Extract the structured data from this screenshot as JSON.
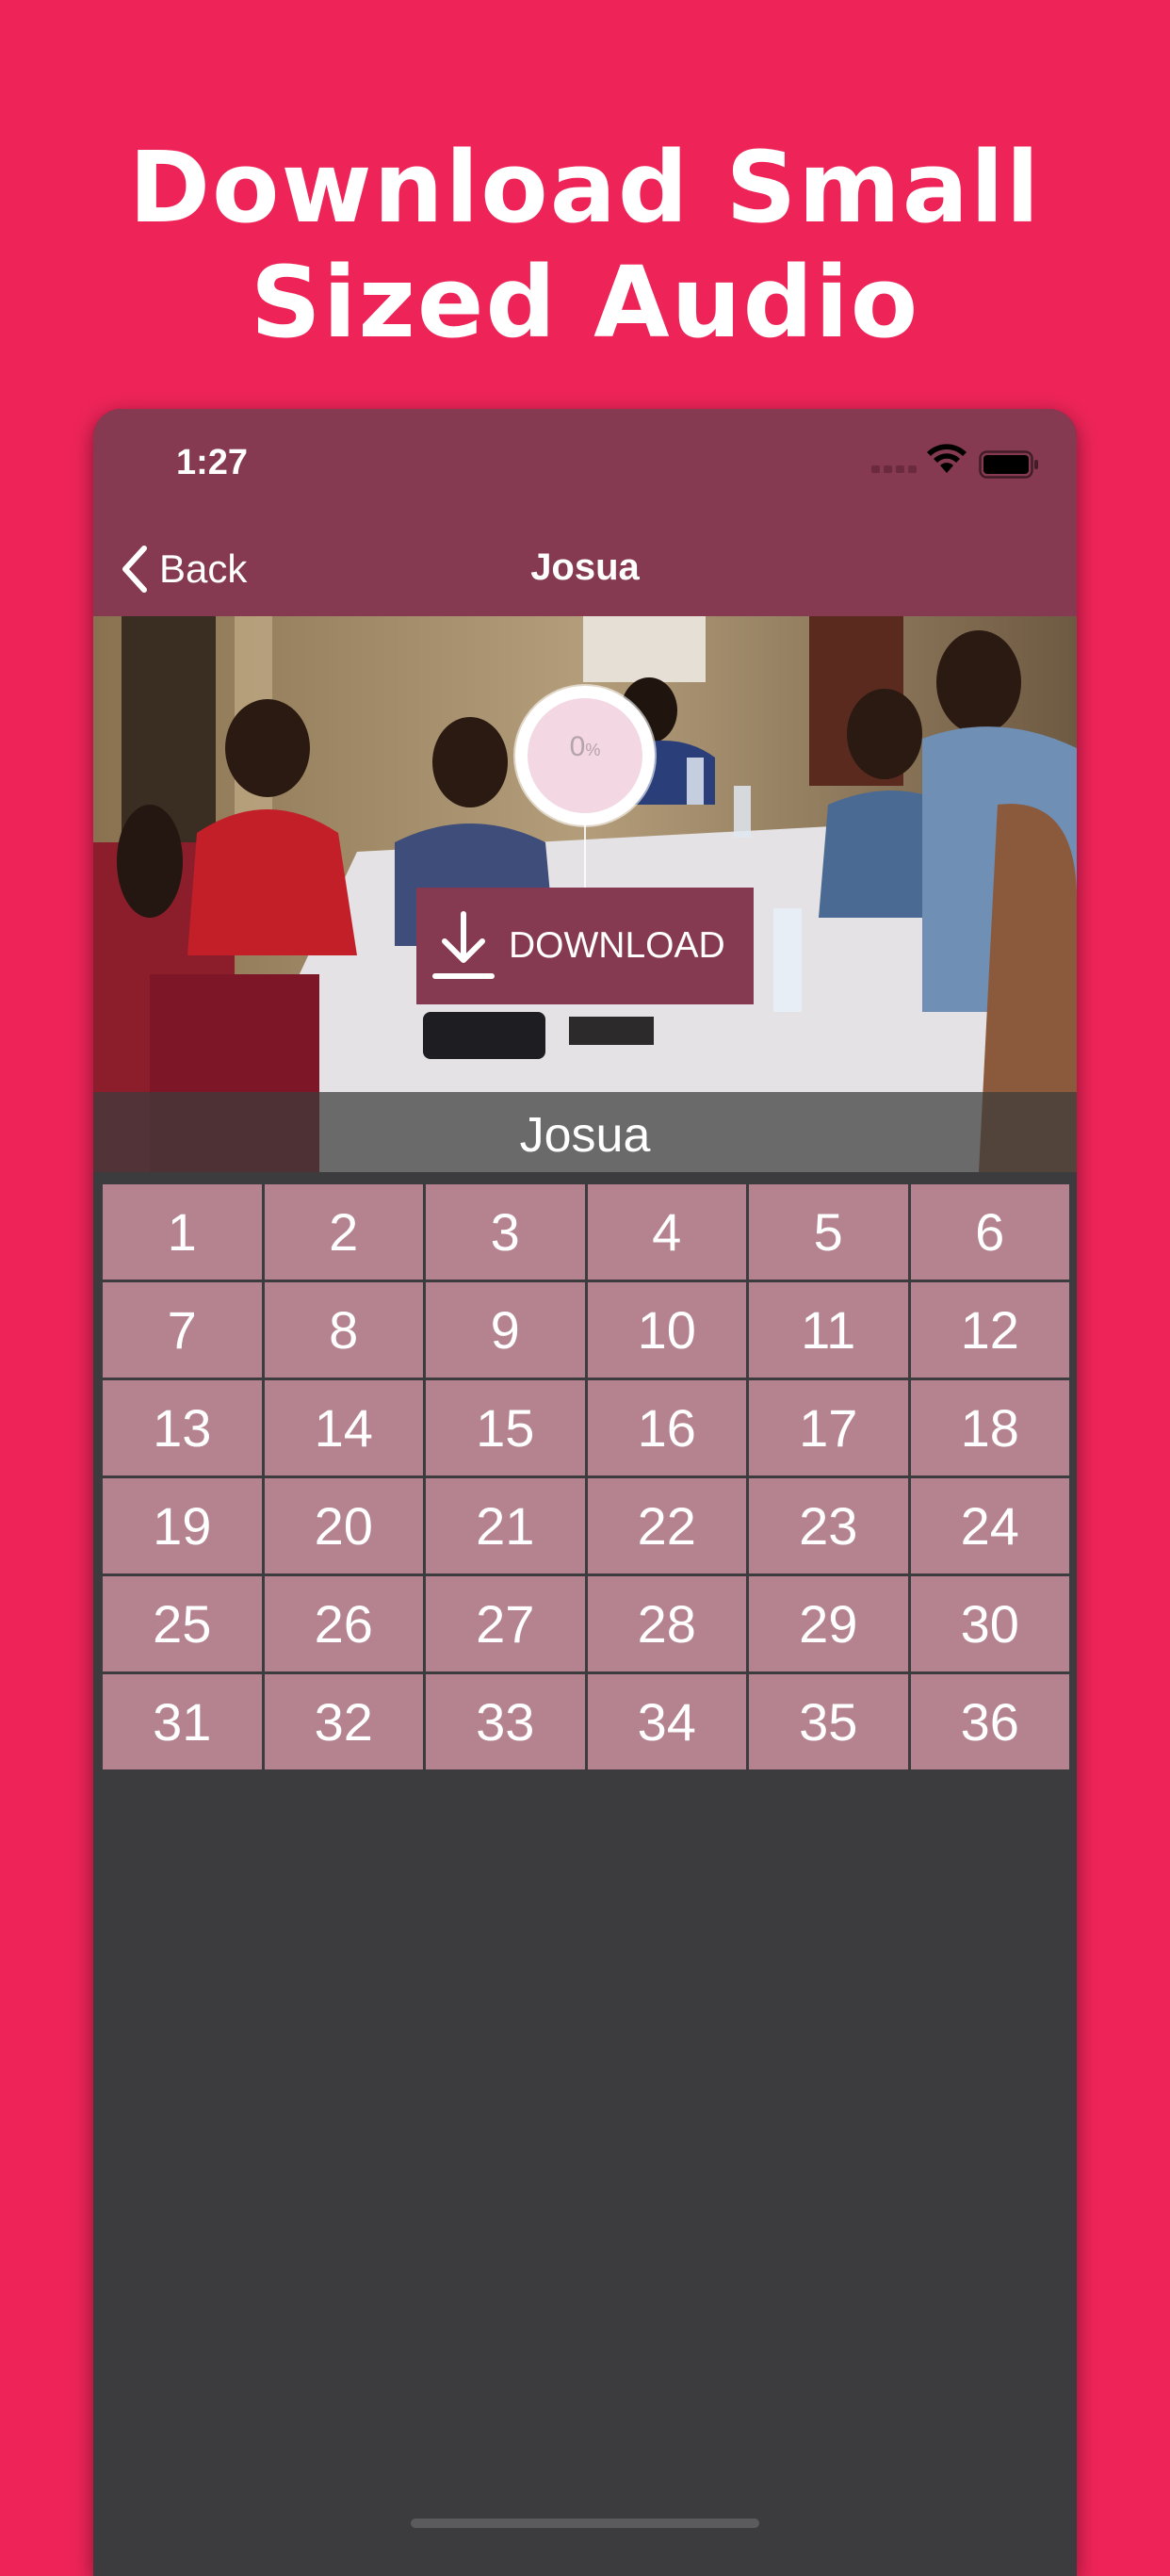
{
  "promo": {
    "title_line1": "Download Small",
    "title_line2": "Sized Audio"
  },
  "status_bar": {
    "time": "1:27",
    "wifi_icon": "wifi-icon",
    "battery_icon": "battery-icon"
  },
  "nav": {
    "back_label": "Back",
    "back_icon": "chevron-left-icon",
    "title": "Josua"
  },
  "hero": {
    "progress_value": "0",
    "progress_unit": "%",
    "download_label": "DOWNLOAD",
    "download_icon": "download-icon",
    "caption": "Josua"
  },
  "chapters": [
    "1",
    "2",
    "3",
    "4",
    "5",
    "6",
    "7",
    "8",
    "9",
    "10",
    "11",
    "12",
    "13",
    "14",
    "15",
    "16",
    "17",
    "18",
    "19",
    "20",
    "21",
    "22",
    "23",
    "24",
    "25",
    "26",
    "27",
    "28",
    "29",
    "30",
    "31",
    "32",
    "33",
    "34",
    "35",
    "36"
  ],
  "colors": {
    "background": "#ee2458",
    "header": "#853a51",
    "chapter_cell": "#b5838f",
    "content_bg": "#3c3c3e"
  }
}
